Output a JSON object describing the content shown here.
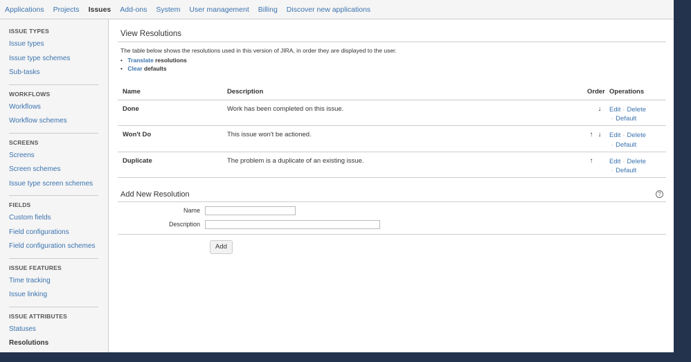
{
  "topnav": [
    {
      "label": "Applications"
    },
    {
      "label": "Projects"
    },
    {
      "label": "Issues",
      "active": true
    },
    {
      "label": "Add-ons"
    },
    {
      "label": "System"
    },
    {
      "label": "User management"
    },
    {
      "label": "Billing"
    },
    {
      "label": "Discover new applications"
    }
  ],
  "sidebar": {
    "sections": [
      {
        "heading": "ISSUE TYPES",
        "items": [
          "Issue types",
          "Issue type schemes",
          "Sub-tasks"
        ]
      },
      {
        "heading": "WORKFLOWS",
        "items": [
          "Workflows",
          "Workflow schemes"
        ]
      },
      {
        "heading": "SCREENS",
        "items": [
          "Screens",
          "Screen schemes",
          "Issue type screen schemes"
        ]
      },
      {
        "heading": "FIELDS",
        "items": [
          "Custom fields",
          "Field configurations",
          "Field configuration schemes"
        ]
      },
      {
        "heading": "ISSUE FEATURES",
        "items": [
          "Time tracking",
          "Issue linking"
        ]
      },
      {
        "heading": "ISSUE ATTRIBUTES",
        "items": [
          "Statuses",
          "Resolutions"
        ]
      }
    ],
    "active_item": "Resolutions"
  },
  "main": {
    "title": "View Resolutions",
    "intro": "The table below shows the resolutions used in this version of JIRA, in order they are displayed to the user.",
    "links": [
      {
        "link": "Translate",
        "rest": "resolutions"
      },
      {
        "link": "Clear",
        "rest": "defaults"
      }
    ],
    "table": {
      "headers": {
        "name": "Name",
        "description": "Description",
        "order": "Order",
        "operations": "Operations"
      },
      "rows": [
        {
          "name": "Done",
          "description": "Work has been completed on this issue.",
          "up": false,
          "down": true
        },
        {
          "name": "Won't Do",
          "description": "This issue won't be actioned.",
          "up": true,
          "down": true
        },
        {
          "name": "Duplicate",
          "description": "The problem is a duplicate of an existing issue.",
          "up": true,
          "down": false
        }
      ],
      "ops": {
        "edit": "Edit",
        "delete": "Delete",
        "default": "Default",
        "separator": "·"
      }
    },
    "add": {
      "title": "Add New Resolution",
      "name_label": "Name",
      "name_value": "",
      "description_label": "Description",
      "description_value": "",
      "button": "Add"
    }
  }
}
